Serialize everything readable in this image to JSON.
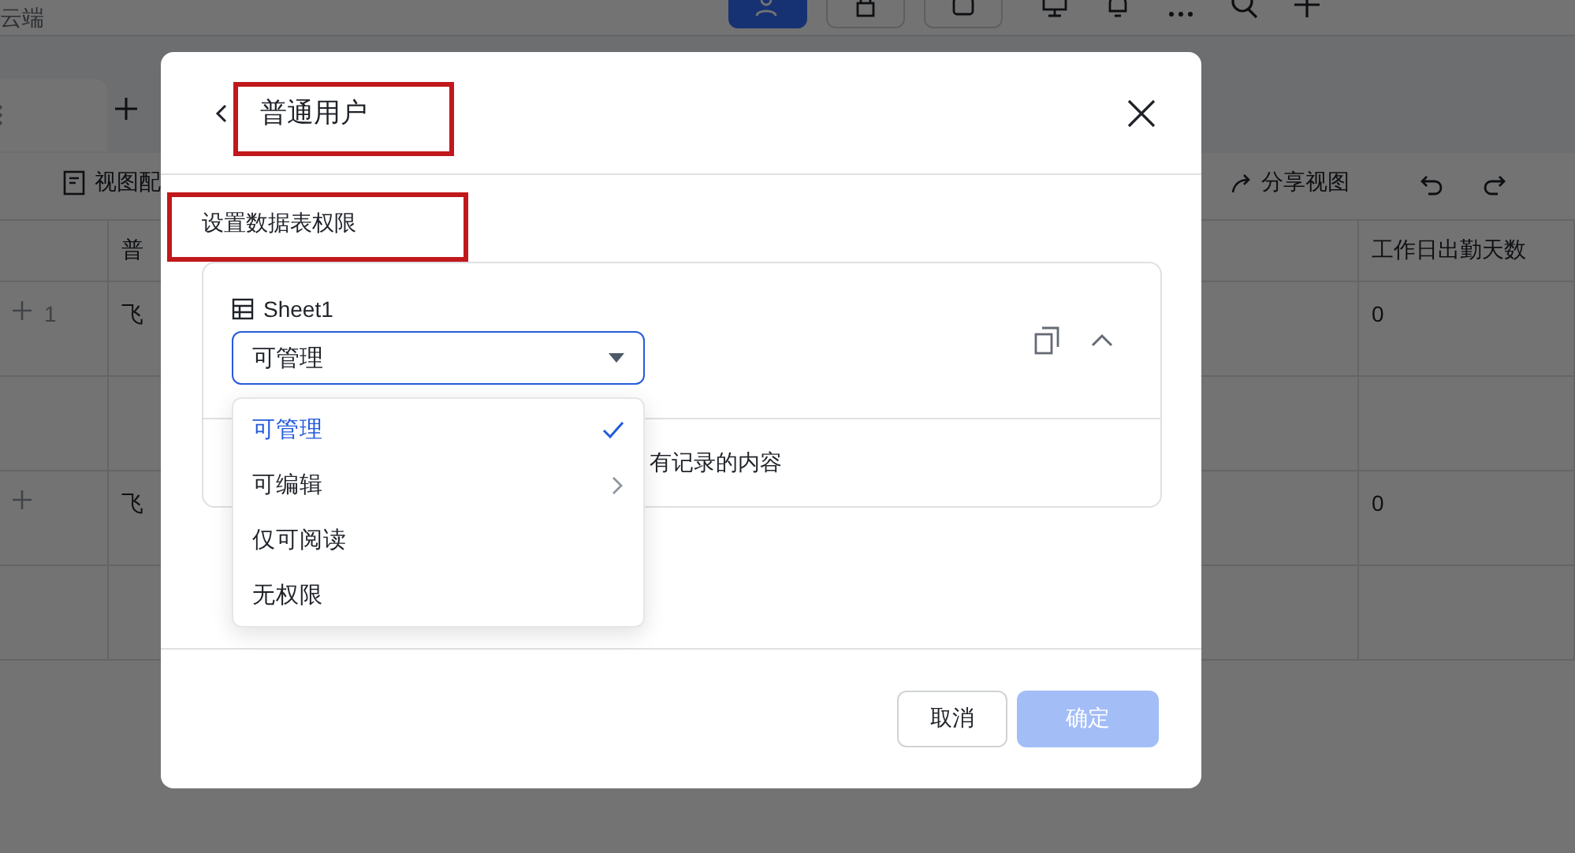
{
  "app": {
    "location": "云端",
    "top_buttons": [
      {
        "kind": "primary"
      },
      {
        "kind": "lock"
      },
      {
        "kind": "robot"
      }
    ],
    "toolbar": {
      "left": [
        "视图配"
      ],
      "share_view": "分享视图"
    },
    "table": {
      "columns": [
        "普",
        "工作日出勤天数"
      ],
      "rows": [
        {
          "index": "1",
          "name": "飞",
          "days": "0"
        },
        {
          "name": "飞",
          "days": "0"
        }
      ]
    }
  },
  "dialog": {
    "title": "普通用户",
    "title_highlighted": true,
    "section_label": "设置数据表权限",
    "section_highlighted": true,
    "sheet": {
      "name": "Sheet1",
      "permission": "可管理",
      "expanded": true,
      "note": "有记录的内容"
    },
    "dropdown": [
      {
        "label": "可管理",
        "selected": true,
        "has_submenu": false
      },
      {
        "label": "可编辑",
        "selected": false,
        "has_submenu": true
      },
      {
        "label": "仅可阅读",
        "selected": false,
        "has_submenu": false
      },
      {
        "label": "无权限",
        "selected": false,
        "has_submenu": false
      }
    ],
    "buttons": [
      {
        "label": "取消",
        "kind": "secondary"
      },
      {
        "label": "确定",
        "kind": "primary"
      }
    ]
  }
}
